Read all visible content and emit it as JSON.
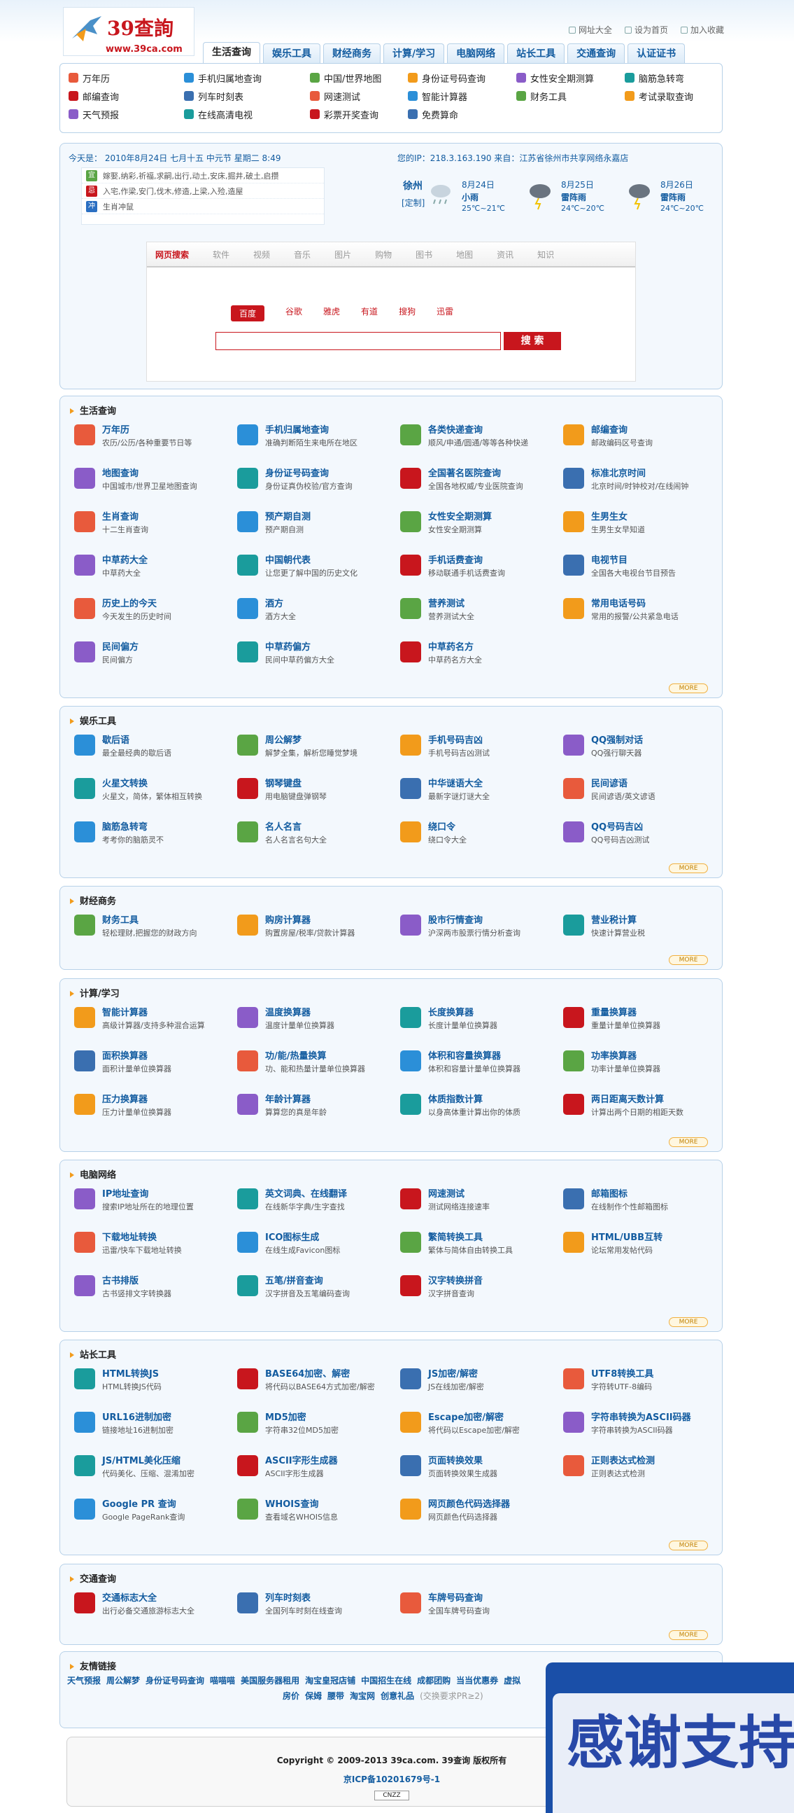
{
  "header": {
    "logo_name": "39查詢",
    "logo_url": "www.39ca.com",
    "links": [
      "网址大全",
      "设为首页",
      "加入收藏"
    ]
  },
  "nav": {
    "tabs": [
      "生活查询",
      "娱乐工具",
      "财经商务",
      "计算/学习",
      "电脑网络",
      "站长工具",
      "交通查询",
      "认证证书"
    ]
  },
  "subnav": {
    "items": [
      "万年历",
      "手机归属地查询",
      "中国/世界地图",
      "身份证号码查询",
      "女性安全期测算",
      "脑筋急转弯",
      "邮编查询",
      "列车时刻表",
      "网速测试",
      "智能计算器",
      "财务工具",
      "考试录取查询",
      "天气预报",
      "在线高清电视",
      "彩票开奖查询",
      "免费算命"
    ]
  },
  "info": {
    "today": "今天是： 2010年8月24日  七月十五  中元节  星期二  8:49",
    "ip": "您的IP：218.3.163.190  来自：江苏省徐州市共享网络永嘉店",
    "almanac": [
      "嫁娶,纳彩,祈福,求嗣,出行,动土,安床,掘井,破土,启攒",
      "入宅,作梁,安门,伐木,修造,上梁,入殓,造屋",
      "生肖冲鼠"
    ],
    "almanac_badges": [
      "宜",
      "忌",
      "冲"
    ],
    "city": "徐州",
    "custom": "[定制]",
    "days": [
      {
        "date": "8月24日",
        "cond": "小雨",
        "temp": "25℃~21℃"
      },
      {
        "date": "8月25日",
        "cond": "雷阵雨",
        "temp": "24℃~20℃"
      },
      {
        "date": "8月26日",
        "cond": "雷阵雨",
        "temp": "24℃~20℃"
      }
    ]
  },
  "search": {
    "tabs": [
      "网页搜索",
      "软件",
      "视频",
      "音乐",
      "图片",
      "购物",
      "图书",
      "地图",
      "资讯",
      "知识"
    ],
    "engines": [
      "百度",
      "谷歌",
      "雅虎",
      "有道",
      "搜狗",
      "迅雷"
    ],
    "button": "搜  索"
  },
  "more_label": "MORE",
  "sections": [
    {
      "title": "生活查询",
      "items": [
        [
          "万年历",
          "农历/公历/各种重要节日等"
        ],
        [
          "手机归属地查询",
          "准确判断陌生来电所在地区"
        ],
        [
          "各类快递查询",
          "顺风/申通/圆通/等等各种快递"
        ],
        [
          "邮编查询",
          "邮政编码区号查询"
        ],
        [
          "地图查询",
          "中国城市/世界卫星地图查询"
        ],
        [
          "身份证号码查询",
          "身份证真伪校验/官方查询"
        ],
        [
          "全国著名医院查询",
          "全国各地权威/专业医院查询"
        ],
        [
          "标准北京时间",
          "北京时间/时钟校对/在线闹钟"
        ],
        [
          "生肖查询",
          "十二生肖查询"
        ],
        [
          "预产期自测",
          "预产期自测"
        ],
        [
          "女性安全期测算",
          "女性安全期测算"
        ],
        [
          "生男生女",
          "生男生女早知道"
        ],
        [
          "中草药大全",
          "中草药大全"
        ],
        [
          "中国朝代表",
          "让您更了解中国的历史文化"
        ],
        [
          "手机话费查询",
          "移动联通手机话费查询"
        ],
        [
          "电视节目",
          "全国各大电视台节目预告"
        ],
        [
          "历史上的今天",
          "今天发生的历史时间"
        ],
        [
          "酒方",
          "酒方大全"
        ],
        [
          "营养测试",
          "营养测试大全"
        ],
        [
          "常用电话号码",
          "常用的报警/公共紧急电话"
        ],
        [
          "民间偏方",
          "民间偏方"
        ],
        [
          "中草药偏方",
          "民间中草药偏方大全"
        ],
        [
          "中草药名方",
          "中草药名方大全"
        ]
      ]
    },
    {
      "title": "娱乐工具",
      "items": [
        [
          "歇后语",
          "最全最经典的歇后语"
        ],
        [
          "周公解梦",
          "解梦全集，解析您睡觉梦境"
        ],
        [
          "手机号码吉凶",
          "手机号码吉凶测试"
        ],
        [
          "QQ强制对话",
          "QQ强行聊天器"
        ],
        [
          "火星文转换",
          "火星文，简体，繁体相互转换"
        ],
        [
          "钢琴键盘",
          "用电脑键盘弹钢琴"
        ],
        [
          "中华谜语大全",
          "最新字谜灯谜大全"
        ],
        [
          "民间谚语",
          "民间谚语/英文谚语"
        ],
        [
          "脑筋急转弯",
          "考考你的脑筋灵不"
        ],
        [
          "名人名言",
          "名人名言名句大全"
        ],
        [
          "绕口令",
          "绕口令大全"
        ],
        [
          "QQ号码吉凶",
          "QQ号码吉凶测试"
        ]
      ]
    },
    {
      "title": "财经商务",
      "items": [
        [
          "财务工具",
          "轻松理财,把握您的财政方向"
        ],
        [
          "购房计算器",
          "购置房屋/税率/贷款计算器"
        ],
        [
          "股市行情查询",
          "沪深两市股票行情分析查询"
        ],
        [
          "营业税计算",
          "快速计算营业税"
        ]
      ]
    },
    {
      "title": "计算/学习",
      "items": [
        [
          "智能计算器",
          "高级计算器/支持多种混合运算"
        ],
        [
          "温度换算器",
          "温度计量单位换算器"
        ],
        [
          "长度换算器",
          "长度计量单位换算器"
        ],
        [
          "重量换算器",
          "重量计量单位换算器"
        ],
        [
          "面积换算器",
          "面积计量单位换算器"
        ],
        [
          "功/能/热量换算",
          "功、能和热量计量单位换算器"
        ],
        [
          "体积和容量换算器",
          "体积和容量计量单位换算器"
        ],
        [
          "功率换算器",
          "功率计量单位换算器"
        ],
        [
          "压力换算器",
          "压力计量单位换算器"
        ],
        [
          "年龄计算器",
          "算算您的真是年龄"
        ],
        [
          "体质指数计算",
          "以身高体重计算出你的体质"
        ],
        [
          "两日距离天数计算",
          "计算出两个日期的相距天数"
        ]
      ]
    },
    {
      "title": "电脑网络",
      "items": [
        [
          "IP地址查询",
          "搜索IP地址所在的地理位置"
        ],
        [
          "英文词典、在线翻译",
          "在线新华字典/生字查找"
        ],
        [
          "网速测试",
          "测试网络连接速率"
        ],
        [
          "邮箱图标",
          "在线制作个性邮箱图标"
        ],
        [
          "下载地址转换",
          "迅雷/快车下载地址转换"
        ],
        [
          "ICO图标生成",
          "在线生成Favicon图标"
        ],
        [
          "繁简转换工具",
          "繁体与简体自由转换工具"
        ],
        [
          "HTML/UBB互转",
          "论坛常用发帖代码"
        ],
        [
          "古书排版",
          "古书竖排文字转换器"
        ],
        [
          "五笔/拼音查询",
          "汉字拼音及五笔编码查询"
        ],
        [
          "汉字转换拼音",
          "汉字拼音查询"
        ]
      ]
    },
    {
      "title": "站长工具",
      "items": [
        [
          "HTML转换JS",
          "HTML转换JS代码"
        ],
        [
          "BASE64加密、解密",
          "将代码以BASE64方式加密/解密"
        ],
        [
          "JS加密/解密",
          "JS在线加密/解密"
        ],
        [
          "UTF8转换工具",
          "字符转UTF-8编码"
        ],
        [
          "URL16进制加密",
          "链接地址16进制加密"
        ],
        [
          "MD5加密",
          "字符串32位MD5加密"
        ],
        [
          "Escape加密/解密",
          "将代码以Escape加密/解密"
        ],
        [
          "字符串转换为ASCII码器",
          "字符串转换为ASCII码器"
        ],
        [
          "JS/HTML美化压缩",
          "代码美化、压缩、混淆加密"
        ],
        [
          "ASCII字形生成器",
          "ASCII字形生成器"
        ],
        [
          "页面转换效果",
          "页面转换效果生成器"
        ],
        [
          "正则表达式检测",
          "正则表达式检测"
        ],
        [
          "Google PR 查询",
          "Google PageRank查询"
        ],
        [
          "WHOIS查询",
          "查看域名WHOIS信息"
        ],
        [
          "网页颜色代码选择器",
          "网页颜色代码选择器"
        ]
      ]
    },
    {
      "title": "交通查询",
      "items": [
        [
          "交通标志大全",
          "出行必备交通旅游标志大全"
        ],
        [
          "列车时刻表",
          "全国列车时刻在线查询"
        ],
        [
          "车牌号码查询",
          "全国车牌号码查询"
        ]
      ]
    }
  ],
  "friends": {
    "title": "友情链接",
    "links": [
      "天气预报",
      "周公解梦",
      "身份证号码查询",
      "喵喵喵",
      "美国服务器租用",
      "淘宝皇冠店铺",
      "中国招生在线",
      "成都团购",
      "当当优惠券",
      "虚拟"
    ],
    "links2": [
      "房价",
      "保姆",
      "腰带",
      "淘宝网",
      "创意礼品"
    ],
    "exchange": "(交换要求PR≥2)"
  },
  "footer": {
    "copyright": "Copyright © 2009-2013 39ca.com. 39查询  版权所有",
    "icp": "京ICP备10201679号-1",
    "badge": "CNZZ"
  },
  "overlay": {
    "text": "感谢支持"
  }
}
